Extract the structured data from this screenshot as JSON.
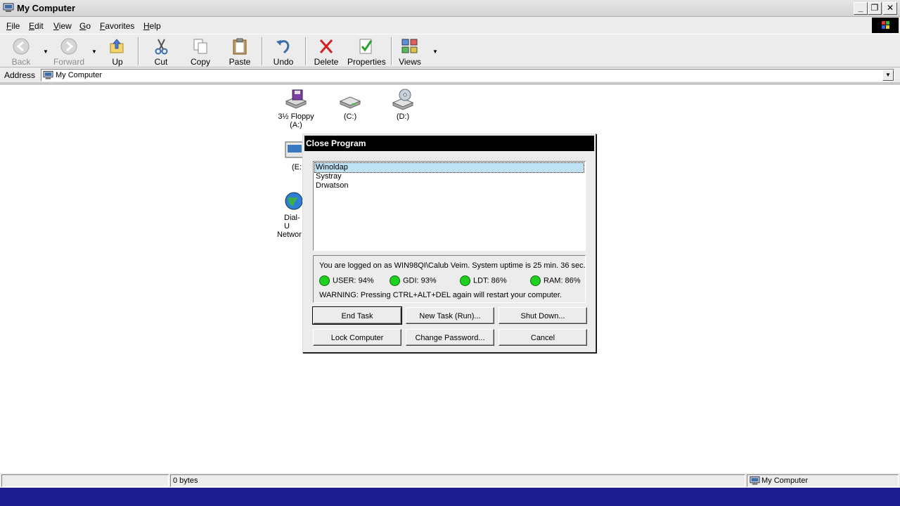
{
  "window": {
    "title": "My Computer",
    "minimize_glyph": "_",
    "restore_glyph": "❐",
    "close_glyph": "✕"
  },
  "menu": [
    "File",
    "Edit",
    "View",
    "Go",
    "Favorites",
    "Help"
  ],
  "toolbar": {
    "back": "Back",
    "forward": "Forward",
    "up": "Up",
    "cut": "Cut",
    "copy": "Copy",
    "paste": "Paste",
    "undo": "Undo",
    "delete": "Delete",
    "properties": "Properties",
    "views": "Views"
  },
  "address": {
    "label": "Address",
    "value": "My Computer"
  },
  "drives": {
    "floppy_line1": "3½ Floppy",
    "floppy_line2": "(A:)",
    "c": "(C:)",
    "d": "(D:)",
    "e_partial": "(E:",
    "dialup_line1": "Dial-U",
    "dialup_line2": "Networ"
  },
  "dialog": {
    "title": "Close Program",
    "processes": [
      "Winoldap",
      "Systray",
      "Drwatson"
    ],
    "selected_index": 0,
    "logon_text": "You are logged on as WIN98QI\\Calub Veim. System uptime is 25 min. 36 sec.",
    "resources": {
      "user": "USER: 94%",
      "gdi": "GDI: 93%",
      "ldt": "LDT: 86%",
      "ram": "RAM: 86%"
    },
    "warning": "WARNING: Pressing CTRL+ALT+DEL again will restart your computer.",
    "buttons": {
      "end_task": "End Task",
      "new_task": "New Task (Run)...",
      "shut_down": "Shut Down...",
      "lock": "Lock Computer",
      "change_password": "Change Password...",
      "cancel": "Cancel"
    }
  },
  "status": {
    "size": "0 bytes",
    "zone": "My Computer"
  },
  "colors": {
    "taskbar": "#1c1c8f",
    "dialog_title": "#000000",
    "resource_ok": "#1fd11f",
    "selection": "#bfe3f5"
  }
}
